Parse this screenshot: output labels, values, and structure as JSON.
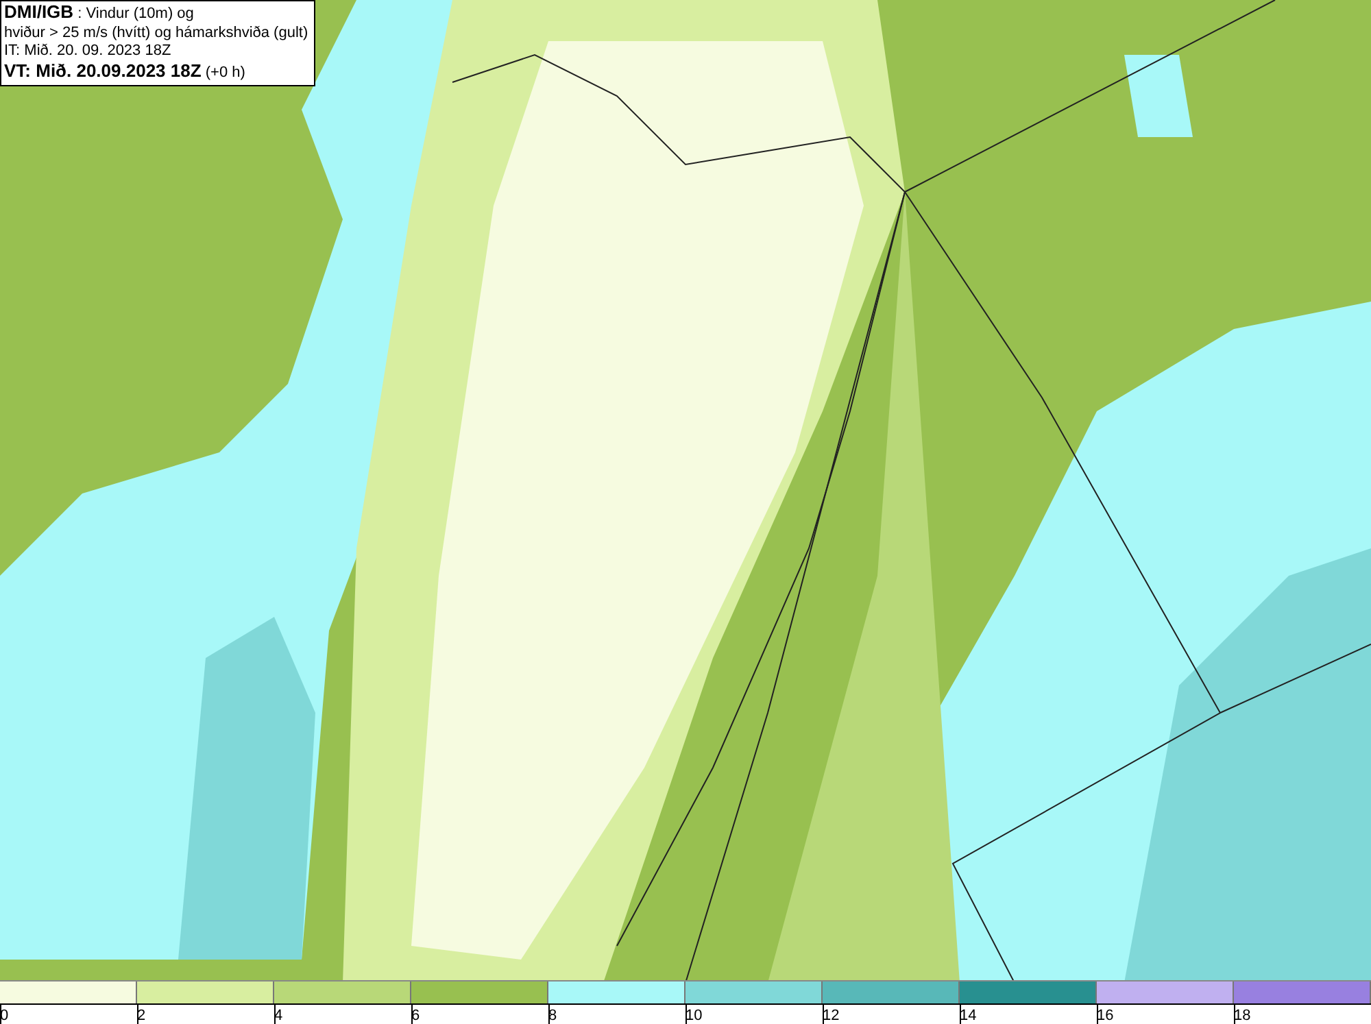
{
  "header": {
    "lines": [
      "**DMI/IGB** : Vindur (10m) og",
      "hviður > 25 m/s (hvítt) og hámarkshviða (gult)",
      "IT: Mið. 20. 09. 2023 18Z",
      "**VT: Mið. 20.09.2023 18Z** (+0 h)"
    ]
  },
  "legend": [
    {
      "label": "0",
      "color": "#f6fbe0"
    },
    {
      "label": "2",
      "color": "#d8eea0"
    },
    {
      "label": "4",
      "color": "#b8d878"
    },
    {
      "label": "6",
      "color": "#98c050"
    },
    {
      "label": "8",
      "color": "#a8f8f8"
    },
    {
      "label": "10",
      "color": "#80d8d8"
    },
    {
      "label": "12",
      "color": "#58b8b8"
    },
    {
      "label": "14",
      "color": "#289090"
    },
    {
      "label": "16",
      "color": "#c0b0f0"
    },
    {
      "label": "18",
      "color": "#9880e0"
    }
  ]
}
